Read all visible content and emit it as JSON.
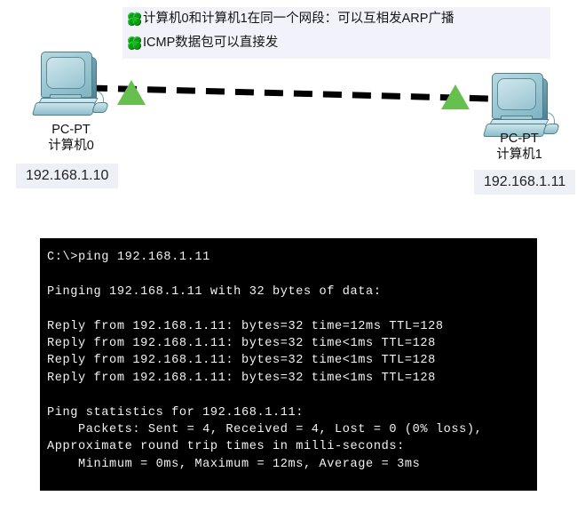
{
  "note": {
    "bullet_icon": "clover-icon",
    "lines": [
      "计算机0和计算机1在同一个网段：可以互相发ARP广播",
      "ICMP数据包可以直接发"
    ]
  },
  "topology": {
    "link_style": "dashed",
    "link_color": "#000000",
    "arrow_color": "#66bf4f",
    "devices": [
      {
        "id": "pc0",
        "model": "PC-PT",
        "name": "计算机0",
        "ip": "192.168.1.10"
      },
      {
        "id": "pc1",
        "model": "PC-PT",
        "name": "计算机1",
        "ip": "192.168.1.11"
      }
    ]
  },
  "terminal": {
    "background": "#000000",
    "foreground": "#f2f2f2",
    "prompt": "C:\\>",
    "command": "ping 192.168.1.11",
    "output": "C:\\>ping 192.168.1.11\n\nPinging 192.168.1.11 with 32 bytes of data:\n\nReply from 192.168.1.11: bytes=32 time=12ms TTL=128\nReply from 192.168.1.11: bytes=32 time<1ms TTL=128\nReply from 192.168.1.11: bytes=32 time<1ms TTL=128\nReply from 192.168.1.11: bytes=32 time<1ms TTL=128\n\nPing statistics for 192.168.1.11:\n    Packets: Sent = 4, Received = 4, Lost = 0 (0% loss),\nApproximate round trip times in milli-seconds:\n    Minimum = 0ms, Maximum = 12ms, Average = 3ms",
    "stats": {
      "target": "192.168.1.11",
      "bytes": 32,
      "sent": 4,
      "received": 4,
      "lost": 0,
      "loss_percent": "0%",
      "minimum_ms": "0ms",
      "maximum_ms": "12ms",
      "average_ms": "3ms",
      "ttl": 128,
      "times": [
        "12ms",
        "<1ms",
        "<1ms",
        "<1ms"
      ]
    }
  }
}
